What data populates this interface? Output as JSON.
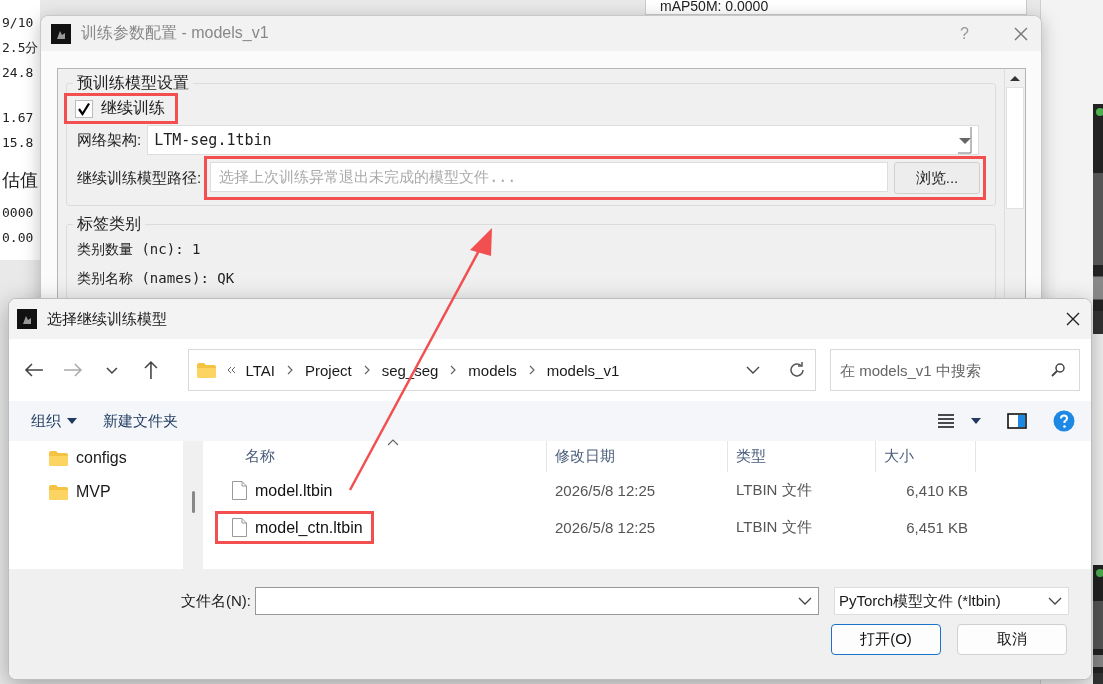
{
  "background_app": {
    "left_values": [
      "9/10",
      "2.5分",
      "24.8",
      "1.67",
      "15.8",
      "估值",
      "0000",
      "0.00"
    ],
    "metric": "mAP50M: 0.0000"
  },
  "config_dialog": {
    "title": "训练参数配置 - models_v1",
    "help": "?",
    "pretrain_group": {
      "title": "预训练模型设置",
      "resume": {
        "label": "继续训练",
        "checked": true,
        "highlighted": true
      },
      "arch": {
        "label": "网络架构:",
        "value": "LTM-seg.1tbin"
      },
      "path": {
        "label": "继续训练模型路径:",
        "placeholder": "选择上次训练异常退出未完成的模型文件...",
        "button": "浏览...",
        "highlighted": true
      }
    },
    "label_group": {
      "title": "标签类别",
      "lines": [
        "类别数量 (nc): 1",
        "类别名称 (names): QK"
      ]
    }
  },
  "file_dialog": {
    "title": "选择继续训练模型",
    "breadcrumb": [
      "LTAI",
      "Project",
      "seg_seg",
      "models",
      "models_v1"
    ],
    "search": {
      "placeholder": "在 models_v1 中搜索"
    },
    "toolbar": [
      {
        "label": "组织",
        "kind": "menu"
      },
      {
        "label": "新建文件夹",
        "kind": "button"
      }
    ],
    "nav_items": [
      "configs",
      "MVP"
    ],
    "columns": [
      "名称",
      "修改日期",
      "类型",
      "大小"
    ],
    "rows": [
      {
        "name": "model.ltbin",
        "date": "2026/5/8 12:25",
        "type": "LTBIN 文件",
        "size": "6,410 KB",
        "highlighted": false
      },
      {
        "name": "model_ctn.ltbin",
        "date": "2026/5/8 12:25",
        "type": "LTBIN 文件",
        "size": "6,451 KB",
        "highlighted": true
      }
    ],
    "filename_label": "文件名(N):",
    "filter": "PyTorch模型文件 (*ltbin)",
    "buttons": [
      {
        "label": "打开(O)",
        "kind": "primary"
      },
      {
        "label": "取消",
        "kind": "normal"
      }
    ]
  }
}
